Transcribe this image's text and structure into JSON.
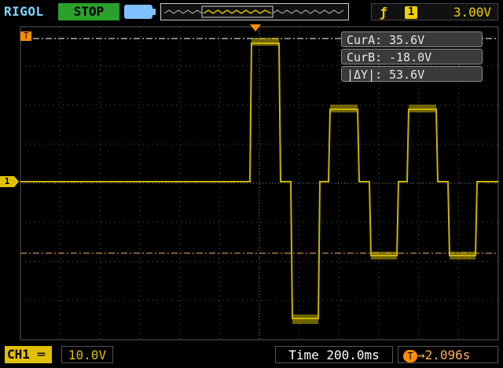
{
  "header": {
    "brand": "RIGOL",
    "run_state": "STOP",
    "trigger_edge_icon": "rising-edge-icon",
    "trigger_source": "1",
    "trigger_level": "3.00V"
  },
  "cursors": {
    "a_label": "CurA:",
    "a_value": "35.6V",
    "b_label": "CurB:",
    "b_value": "-18.0V",
    "dy_label": "|ΔY|:",
    "dy_value": "53.6V"
  },
  "footer": {
    "ch1_label": "CH1",
    "ch1_scale": "10.0V",
    "timebase": "Time 200.0ms",
    "trigger_delay": "2.096s",
    "delay_icon": "T"
  },
  "markers": {
    "channel": "1",
    "trigger_top": "T"
  },
  "colors": {
    "trace": "#c8b400",
    "grid": "#5a5a5a",
    "cursor": "#ffb060",
    "brand": "#7fd3ff",
    "stop": "#2aa12a"
  }
}
